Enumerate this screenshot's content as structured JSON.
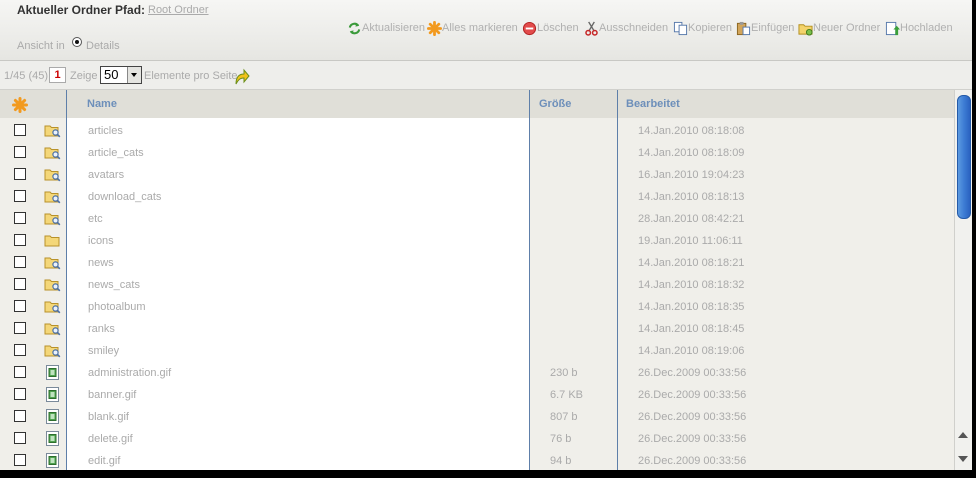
{
  "header": {
    "path_label": "Aktueller Ordner Pfad:",
    "path_link": "Root Ordner",
    "view_label": "Ansicht in",
    "view_option": "Details"
  },
  "toolbar": [
    {
      "label": "Aktualisieren",
      "icon": "refresh-icon"
    },
    {
      "label": "Alles markieren",
      "icon": "select-all-icon"
    },
    {
      "label": "Löschen",
      "icon": "delete-icon"
    },
    {
      "label": "Ausschneiden",
      "icon": "cut-icon"
    },
    {
      "label": "Kopieren",
      "icon": "copy-icon"
    },
    {
      "label": "Einfügen",
      "icon": "paste-icon"
    },
    {
      "label": "Neuer Ordner",
      "icon": "new-folder-icon"
    },
    {
      "label": "Hochladen",
      "icon": "upload-icon"
    }
  ],
  "pager": {
    "count": "1/45 (45)",
    "page": "1",
    "show": "Zeige",
    "per_page": "50",
    "per_page_text": "Elemente pro Seite"
  },
  "columns": {
    "name": "Name",
    "size": "Größe",
    "modified": "Bearbeitet"
  },
  "rows": [
    {
      "type": "folder",
      "name": "articles",
      "size": "",
      "date": "14.Jan.2010 08:18:08"
    },
    {
      "type": "folder",
      "name": "article_cats",
      "size": "",
      "date": "14.Jan.2010 08:18:09"
    },
    {
      "type": "folder",
      "name": "avatars",
      "size": "",
      "date": "16.Jan.2010 19:04:23"
    },
    {
      "type": "folder",
      "name": "download_cats",
      "size": "",
      "date": "14.Jan.2010 08:18:13"
    },
    {
      "type": "folder",
      "name": "etc",
      "size": "",
      "date": "28.Jan.2010 08:42:21"
    },
    {
      "type": "folder-plain",
      "name": "icons",
      "size": "",
      "date": "19.Jan.2010 11:06:11"
    },
    {
      "type": "folder",
      "name": "news",
      "size": "",
      "date": "14.Jan.2010 08:18:21"
    },
    {
      "type": "folder",
      "name": "news_cats",
      "size": "",
      "date": "14.Jan.2010 08:18:32"
    },
    {
      "type": "folder",
      "name": "photoalbum",
      "size": "",
      "date": "14.Jan.2010 08:18:35"
    },
    {
      "type": "folder",
      "name": "ranks",
      "size": "",
      "date": "14.Jan.2010 08:18:45"
    },
    {
      "type": "folder",
      "name": "smiley",
      "size": "",
      "date": "14.Jan.2010 08:19:06"
    },
    {
      "type": "image",
      "name": "administration.gif",
      "size": "230 b",
      "date": "26.Dec.2009 00:33:56"
    },
    {
      "type": "image",
      "name": "banner.gif",
      "size": "6.7 KB",
      "date": "26.Dec.2009 00:33:56"
    },
    {
      "type": "image",
      "name": "blank.gif",
      "size": "807 b",
      "date": "26.Dec.2009 00:33:56"
    },
    {
      "type": "image",
      "name": "delete.gif",
      "size": "76 b",
      "date": "26.Dec.2009 00:33:56"
    },
    {
      "type": "image",
      "name": "edit.gif",
      "size": "94 b",
      "date": "26.Dec.2009 00:33:56"
    }
  ],
  "colors": {
    "header_text": "#6d8fba",
    "column_line": "#5e7fa9",
    "scroll_thumb": "#3d7cd4"
  }
}
